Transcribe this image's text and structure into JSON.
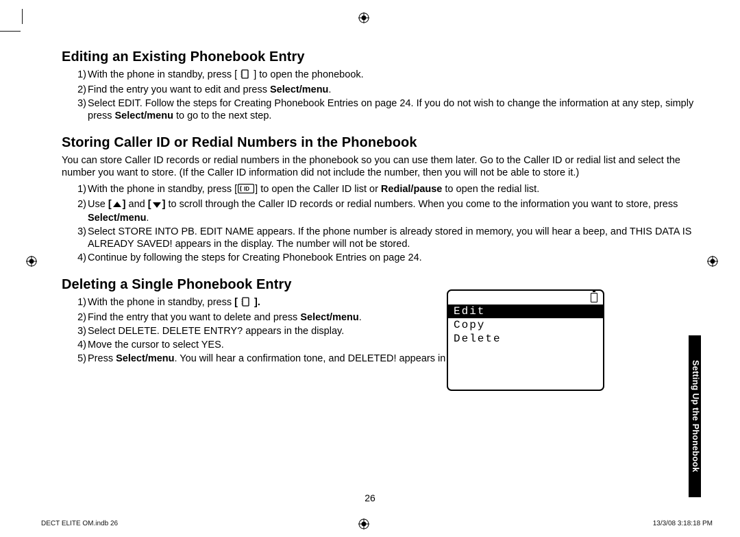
{
  "sections": {
    "editing": {
      "heading": "Editing an Existing Phonebook Entry",
      "items": [
        {
          "num": "1)",
          "pre": "With the phone in standby, press [ ",
          "post": " ] to open the phonebook."
        },
        {
          "num": "2)",
          "textA": "Find the entry you want to edit and press ",
          "bold": "Select/menu",
          "textB": "."
        },
        {
          "num": "3)",
          "textA": "Select EDIT. Follow the steps for Creating Phonebook Entries on page 24. If you do not wish to change the information at any step, simply press ",
          "bold": "Select/menu",
          "textB": " to go to the next step."
        }
      ]
    },
    "storing": {
      "heading": "Storing Caller ID or Redial Numbers in the Phonebook",
      "intro": "You can store Caller ID records or redial numbers in the phonebook so you can use them later. Go to the Caller ID or redial list and select the number you want to store. (If the Caller ID information did not include the number, then you will not be able to store it.)",
      "items": [
        {
          "num": "1)",
          "a": "With the phone in standby, press [",
          "b": "] to open the Caller ID list or ",
          "bold1": "Redial/pause",
          "c": " to open the redial list."
        },
        {
          "num": "2)",
          "a": "Use ",
          "b": " and ",
          "c": " to scroll through the Caller ID records or redial numbers. When you come to the information you want to store, press ",
          "bold1": "Select/menu",
          "d": "."
        },
        {
          "num": "3)",
          "text": "Select STORE INTO PB. EDIT NAME appears. If the phone number is already stored in memory, you will hear a beep, and THIS DATA IS ALREADY SAVED! appears in the display. The number will not be stored."
        },
        {
          "num": "4)",
          "text": "Continue by following the steps for Creating Phonebook Entries on page 24."
        }
      ]
    },
    "deleting": {
      "heading": "Deleting a Single Phonebook Entry",
      "items": [
        {
          "num": "1)",
          "a": "With the phone in standby, press ",
          "bold": "[",
          "b": " ]."
        },
        {
          "num": "2)",
          "a": "Find the entry that you want to delete and press ",
          "bold": "Select/menu",
          "b": "."
        },
        {
          "num": "3)",
          "text": "Select DELETE. DELETE ENTRY? appears in the display."
        },
        {
          "num": "4)",
          "text": "Move the cursor to select YES."
        },
        {
          "num": "5)",
          "a": "Press ",
          "bold": "Select/menu",
          "b": ". You will hear a confirmation tone, and DELETED! appears in the display."
        }
      ]
    }
  },
  "screen": {
    "row1": "Edit",
    "row2": "Copy",
    "row3": "Delete"
  },
  "sidetab": "Setting Up the Phonebook",
  "pageNumber": "26",
  "footer": {
    "left": "DECT ELITE OM.indb   26",
    "right": "13/3/08   3:18:18 PM"
  }
}
